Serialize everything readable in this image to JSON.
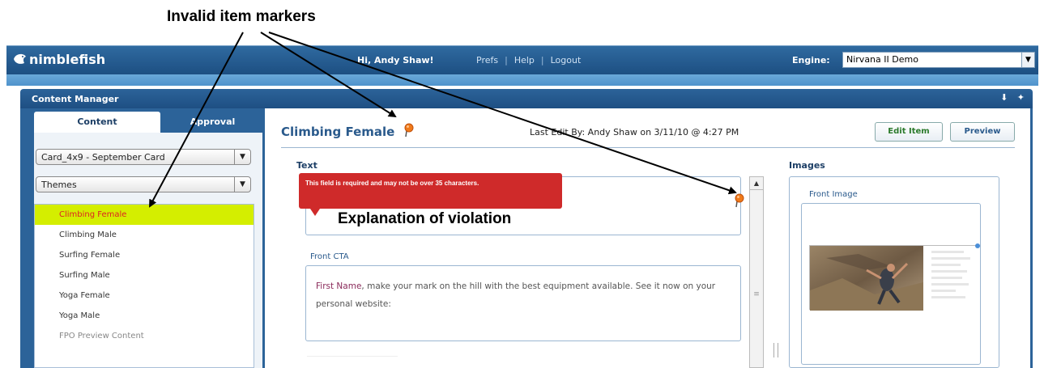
{
  "annotations": {
    "title": "Invalid item markers",
    "violation": "Explanation of violation"
  },
  "header": {
    "logo": "nimblefish",
    "greeting": "Hi, Andy Shaw!",
    "links": [
      "Prefs",
      "Help",
      "Logout"
    ],
    "engine_label": "Engine:",
    "engine_value": "Nirvana II Demo"
  },
  "panel": {
    "title": "Content Manager"
  },
  "left": {
    "tabs": [
      "Content",
      "Approval"
    ],
    "card_select": "Card_4x9 - September Card",
    "theme_select": "Themes",
    "items": [
      {
        "label": "Climbing Female",
        "selected": true
      },
      {
        "label": "Climbing Male"
      },
      {
        "label": "Surfing Female"
      },
      {
        "label": "Surfing Male"
      },
      {
        "label": "Yoga Female"
      },
      {
        "label": "Yoga Male"
      },
      {
        "label": "FPO Preview Content"
      }
    ]
  },
  "main": {
    "item_title": "Climbing Female",
    "last_edit": "Last Edit By: Andy Shaw on 3/11/10 @ 4:27 PM",
    "edit_button": "Edit Item",
    "preview_button": "Preview",
    "text_section": "Text",
    "error_message": "This field is required and may not be over 35 characters.",
    "cta_label": "Front CTA",
    "cta_name": "First Name",
    "cta_text": ", make your mark on the hill with the best equipment available. See it now on your personal website:",
    "images_section": "Images",
    "front_image_label": "Front Image"
  },
  "colors": {
    "header_blue": "#1d4f82",
    "selected_item_bg": "#d4ee00",
    "selected_item_text": "#dd2222",
    "error_red": "#cf2a2a",
    "marker_orange": "#f07a1a"
  }
}
